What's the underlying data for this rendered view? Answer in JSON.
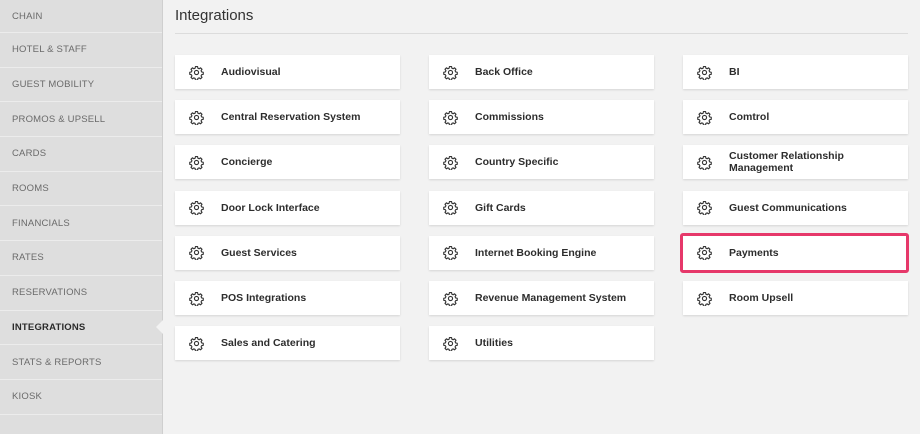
{
  "sidebar": {
    "items": [
      {
        "label": "CHAIN",
        "active": false
      },
      {
        "label": "HOTEL & STAFF",
        "active": false
      },
      {
        "label": "GUEST MOBILITY",
        "active": false
      },
      {
        "label": "PROMOS & UPSELL",
        "active": false
      },
      {
        "label": "CARDS",
        "active": false
      },
      {
        "label": "ROOMS",
        "active": false
      },
      {
        "label": "FINANCIALS",
        "active": false
      },
      {
        "label": "RATES",
        "active": false
      },
      {
        "label": "RESERVATIONS",
        "active": false
      },
      {
        "label": "INTEGRATIONS",
        "active": true
      },
      {
        "label": "STATS & REPORTS",
        "active": false
      },
      {
        "label": "KIOSK",
        "active": false
      }
    ]
  },
  "main": {
    "title": "Integrations",
    "cards": [
      {
        "label": "Audiovisual",
        "icon": "gear-icon"
      },
      {
        "label": "Back Office",
        "icon": "gear-icon"
      },
      {
        "label": "BI",
        "icon": "gear-icon"
      },
      {
        "label": "Central Reservation System",
        "icon": "gear-icon"
      },
      {
        "label": "Commissions",
        "icon": "gear-icon"
      },
      {
        "label": "Comtrol",
        "icon": "gear-icon"
      },
      {
        "label": "Concierge",
        "icon": "gear-icon"
      },
      {
        "label": "Country Specific",
        "icon": "gear-icon"
      },
      {
        "label": "Customer Relationship Management",
        "icon": "gear-icon"
      },
      {
        "label": "Door Lock Interface",
        "icon": "gear-icon"
      },
      {
        "label": "Gift Cards",
        "icon": "gear-icon"
      },
      {
        "label": "Guest Communications",
        "icon": "gear-icon"
      },
      {
        "label": "Guest Services",
        "icon": "gear-icon"
      },
      {
        "label": "Internet Booking Engine",
        "icon": "gear-icon"
      },
      {
        "label": "Payments",
        "icon": "gear-icon",
        "highlighted": true
      },
      {
        "label": "POS Integrations",
        "icon": "gear-icon"
      },
      {
        "label": "Revenue Management System",
        "icon": "gear-icon"
      },
      {
        "label": "Room Upsell",
        "icon": "gear-icon"
      },
      {
        "label": "Sales and Catering",
        "icon": "gear-icon"
      },
      {
        "label": "Utilities",
        "icon": "gear-icon"
      }
    ]
  },
  "colors": {
    "sidebar_bg": "#dedede",
    "page_bg": "#f2f2f2",
    "card_bg": "#ffffff",
    "highlight": "#e6386a"
  }
}
